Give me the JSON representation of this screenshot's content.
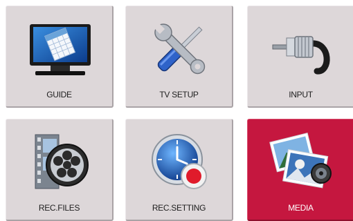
{
  "menu": {
    "items": [
      {
        "label": "GUIDE",
        "icon": "guide-monitor-icon",
        "selected": false
      },
      {
        "label": "TV SETUP",
        "icon": "tools-icon",
        "selected": false
      },
      {
        "label": "INPUT",
        "icon": "cable-plug-icon",
        "selected": false
      },
      {
        "label": "REC.FILES",
        "icon": "film-reel-icon",
        "selected": false
      },
      {
        "label": "REC.SETTING",
        "icon": "clock-record-icon",
        "selected": false
      },
      {
        "label": "MEDIA",
        "icon": "photo-media-icon",
        "selected": true
      }
    ],
    "colors": {
      "tile_background": "#ddd7d9",
      "selected_background": "#c5173f",
      "label_text": "#1e1e1e",
      "selected_label_text": "#ffffff"
    }
  }
}
